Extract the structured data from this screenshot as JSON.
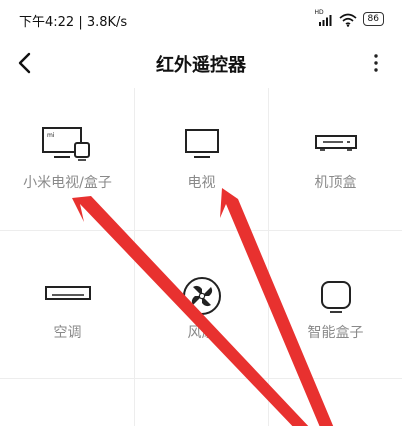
{
  "status_bar": {
    "time_speed": "下午4:22 | 3.8K/s",
    "signal_label": "HD",
    "battery": "86"
  },
  "header": {
    "title": "红外遥控器"
  },
  "devices": [
    {
      "label": "小米电视/盒子",
      "icon": "mi-tv-box-icon"
    },
    {
      "label": "电视",
      "icon": "tv-icon"
    },
    {
      "label": "机顶盒",
      "icon": "set-top-box-icon"
    },
    {
      "label": "空调",
      "icon": "air-conditioner-icon"
    },
    {
      "label": "风扇",
      "icon": "fan-icon"
    },
    {
      "label": "智能盒子",
      "icon": "smart-box-icon"
    }
  ],
  "annotation": {
    "arrow_color": "#e8312f"
  }
}
